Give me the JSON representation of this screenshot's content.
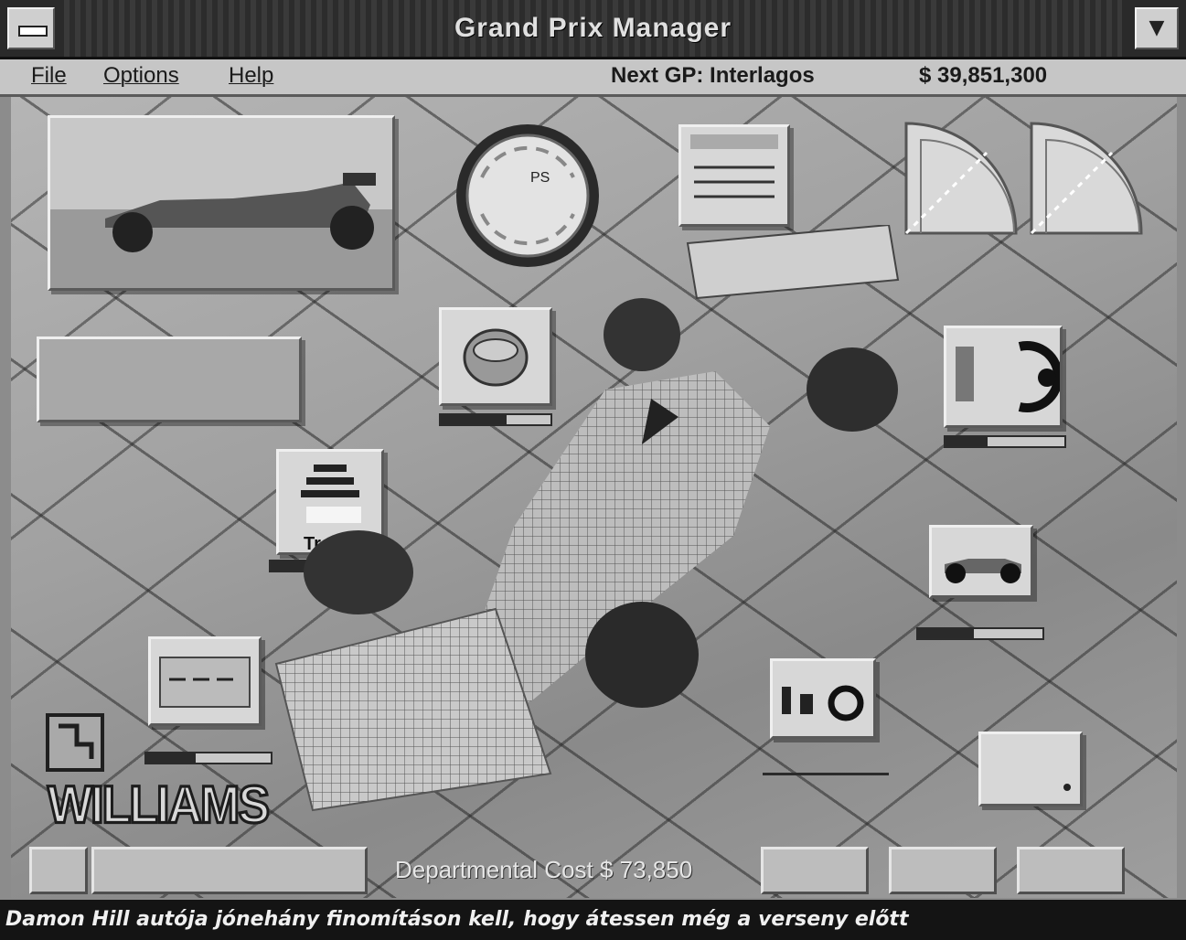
{
  "window": {
    "title": "Grand Prix Manager"
  },
  "menu": {
    "file": "File",
    "options": "Options",
    "help": "Help",
    "next_gp": "Next GP: Interlagos",
    "money": "$ 39,851,300"
  },
  "scene": {
    "gauge_label": "PS",
    "treble_label": "Treble",
    "team_name": "WILLIAMS",
    "departmental_cost": "Departmental Cost $ 73,850",
    "meters": {
      "tyre": 0.6,
      "wing": 0.35,
      "treble": 0.45,
      "car_side": 0.45,
      "gearbox": 0.4,
      "suspension": 0.4
    }
  },
  "status": {
    "message": "Damon Hill autója jónehány finomításon kell, hogy átessen még a verseny előtt"
  },
  "icons": {
    "system_menu": "system-menu-icon",
    "minimize": "minimize-icon",
    "gauge": "pressure-gauge-icon",
    "tyre": "tyre-icon",
    "engine": "engine-icon",
    "car": "car-side-icon",
    "gearbox": "gearbox-icon",
    "logo": "williams-logo-icon"
  }
}
